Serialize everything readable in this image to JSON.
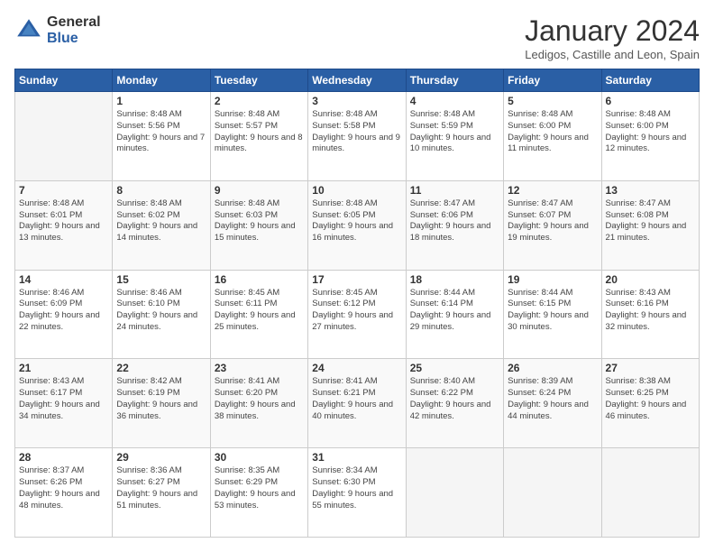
{
  "logo": {
    "general": "General",
    "blue": "Blue"
  },
  "title": "January 2024",
  "location": "Ledigos, Castille and Leon, Spain",
  "weekdays": [
    "Sunday",
    "Monday",
    "Tuesday",
    "Wednesday",
    "Thursday",
    "Friday",
    "Saturday"
  ],
  "weeks": [
    [
      {
        "day": "",
        "sunrise": "",
        "sunset": "",
        "daylight": ""
      },
      {
        "day": "1",
        "sunrise": "Sunrise: 8:48 AM",
        "sunset": "Sunset: 5:56 PM",
        "daylight": "Daylight: 9 hours and 7 minutes."
      },
      {
        "day": "2",
        "sunrise": "Sunrise: 8:48 AM",
        "sunset": "Sunset: 5:57 PM",
        "daylight": "Daylight: 9 hours and 8 minutes."
      },
      {
        "day": "3",
        "sunrise": "Sunrise: 8:48 AM",
        "sunset": "Sunset: 5:58 PM",
        "daylight": "Daylight: 9 hours and 9 minutes."
      },
      {
        "day": "4",
        "sunrise": "Sunrise: 8:48 AM",
        "sunset": "Sunset: 5:59 PM",
        "daylight": "Daylight: 9 hours and 10 minutes."
      },
      {
        "day": "5",
        "sunrise": "Sunrise: 8:48 AM",
        "sunset": "Sunset: 6:00 PM",
        "daylight": "Daylight: 9 hours and 11 minutes."
      },
      {
        "day": "6",
        "sunrise": "Sunrise: 8:48 AM",
        "sunset": "Sunset: 6:00 PM",
        "daylight": "Daylight: 9 hours and 12 minutes."
      }
    ],
    [
      {
        "day": "7",
        "sunrise": "Sunrise: 8:48 AM",
        "sunset": "Sunset: 6:01 PM",
        "daylight": "Daylight: 9 hours and 13 minutes."
      },
      {
        "day": "8",
        "sunrise": "Sunrise: 8:48 AM",
        "sunset": "Sunset: 6:02 PM",
        "daylight": "Daylight: 9 hours and 14 minutes."
      },
      {
        "day": "9",
        "sunrise": "Sunrise: 8:48 AM",
        "sunset": "Sunset: 6:03 PM",
        "daylight": "Daylight: 9 hours and 15 minutes."
      },
      {
        "day": "10",
        "sunrise": "Sunrise: 8:48 AM",
        "sunset": "Sunset: 6:05 PM",
        "daylight": "Daylight: 9 hours and 16 minutes."
      },
      {
        "day": "11",
        "sunrise": "Sunrise: 8:47 AM",
        "sunset": "Sunset: 6:06 PM",
        "daylight": "Daylight: 9 hours and 18 minutes."
      },
      {
        "day": "12",
        "sunrise": "Sunrise: 8:47 AM",
        "sunset": "Sunset: 6:07 PM",
        "daylight": "Daylight: 9 hours and 19 minutes."
      },
      {
        "day": "13",
        "sunrise": "Sunrise: 8:47 AM",
        "sunset": "Sunset: 6:08 PM",
        "daylight": "Daylight: 9 hours and 21 minutes."
      }
    ],
    [
      {
        "day": "14",
        "sunrise": "Sunrise: 8:46 AM",
        "sunset": "Sunset: 6:09 PM",
        "daylight": "Daylight: 9 hours and 22 minutes."
      },
      {
        "day": "15",
        "sunrise": "Sunrise: 8:46 AM",
        "sunset": "Sunset: 6:10 PM",
        "daylight": "Daylight: 9 hours and 24 minutes."
      },
      {
        "day": "16",
        "sunrise": "Sunrise: 8:45 AM",
        "sunset": "Sunset: 6:11 PM",
        "daylight": "Daylight: 9 hours and 25 minutes."
      },
      {
        "day": "17",
        "sunrise": "Sunrise: 8:45 AM",
        "sunset": "Sunset: 6:12 PM",
        "daylight": "Daylight: 9 hours and 27 minutes."
      },
      {
        "day": "18",
        "sunrise": "Sunrise: 8:44 AM",
        "sunset": "Sunset: 6:14 PM",
        "daylight": "Daylight: 9 hours and 29 minutes."
      },
      {
        "day": "19",
        "sunrise": "Sunrise: 8:44 AM",
        "sunset": "Sunset: 6:15 PM",
        "daylight": "Daylight: 9 hours and 30 minutes."
      },
      {
        "day": "20",
        "sunrise": "Sunrise: 8:43 AM",
        "sunset": "Sunset: 6:16 PM",
        "daylight": "Daylight: 9 hours and 32 minutes."
      }
    ],
    [
      {
        "day": "21",
        "sunrise": "Sunrise: 8:43 AM",
        "sunset": "Sunset: 6:17 PM",
        "daylight": "Daylight: 9 hours and 34 minutes."
      },
      {
        "day": "22",
        "sunrise": "Sunrise: 8:42 AM",
        "sunset": "Sunset: 6:19 PM",
        "daylight": "Daylight: 9 hours and 36 minutes."
      },
      {
        "day": "23",
        "sunrise": "Sunrise: 8:41 AM",
        "sunset": "Sunset: 6:20 PM",
        "daylight": "Daylight: 9 hours and 38 minutes."
      },
      {
        "day": "24",
        "sunrise": "Sunrise: 8:41 AM",
        "sunset": "Sunset: 6:21 PM",
        "daylight": "Daylight: 9 hours and 40 minutes."
      },
      {
        "day": "25",
        "sunrise": "Sunrise: 8:40 AM",
        "sunset": "Sunset: 6:22 PM",
        "daylight": "Daylight: 9 hours and 42 minutes."
      },
      {
        "day": "26",
        "sunrise": "Sunrise: 8:39 AM",
        "sunset": "Sunset: 6:24 PM",
        "daylight": "Daylight: 9 hours and 44 minutes."
      },
      {
        "day": "27",
        "sunrise": "Sunrise: 8:38 AM",
        "sunset": "Sunset: 6:25 PM",
        "daylight": "Daylight: 9 hours and 46 minutes."
      }
    ],
    [
      {
        "day": "28",
        "sunrise": "Sunrise: 8:37 AM",
        "sunset": "Sunset: 6:26 PM",
        "daylight": "Daylight: 9 hours and 48 minutes."
      },
      {
        "day": "29",
        "sunrise": "Sunrise: 8:36 AM",
        "sunset": "Sunset: 6:27 PM",
        "daylight": "Daylight: 9 hours and 51 minutes."
      },
      {
        "day": "30",
        "sunrise": "Sunrise: 8:35 AM",
        "sunset": "Sunset: 6:29 PM",
        "daylight": "Daylight: 9 hours and 53 minutes."
      },
      {
        "day": "31",
        "sunrise": "Sunrise: 8:34 AM",
        "sunset": "Sunset: 6:30 PM",
        "daylight": "Daylight: 9 hours and 55 minutes."
      },
      {
        "day": "",
        "sunrise": "",
        "sunset": "",
        "daylight": ""
      },
      {
        "day": "",
        "sunrise": "",
        "sunset": "",
        "daylight": ""
      },
      {
        "day": "",
        "sunrise": "",
        "sunset": "",
        "daylight": ""
      }
    ]
  ]
}
